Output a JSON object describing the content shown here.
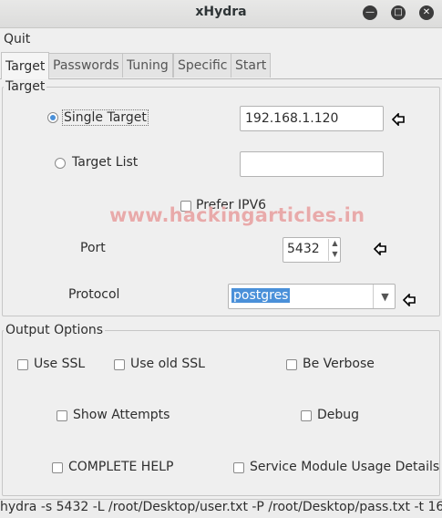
{
  "window": {
    "title": "xHydra"
  },
  "menu": {
    "quit": "Quit"
  },
  "tabs": [
    {
      "label": "Target",
      "active": true
    },
    {
      "label": "Passwords",
      "active": false
    },
    {
      "label": "Tuning",
      "active": false
    },
    {
      "label": "Specific",
      "active": false
    },
    {
      "label": "Start",
      "active": false
    }
  ],
  "target": {
    "frame_title": "Target",
    "single_target_label": "Single Target",
    "single_target_value": "192.168.1.120",
    "target_list_label": "Target List",
    "target_list_value": "",
    "prefer_ipv6_label": "Prefer IPV6",
    "port_label": "Port",
    "port_value": "5432",
    "protocol_label": "Protocol",
    "protocol_value": "postgres"
  },
  "watermark": "www.hackingarticles.in",
  "output": {
    "frame_title": "Output Options",
    "use_ssl": "Use SSL",
    "use_old_ssl": "Use old SSL",
    "be_verbose": "Be Verbose",
    "show_attempts": "Show Attempts",
    "debug": "Debug",
    "complete_help": "COMPLETE HELP",
    "service_module": "Service Module Usage Details"
  },
  "status": {
    "command": "hydra -s 5432 -L /root/Desktop/user.txt -P /root/Desktop/pass.txt -t 16..."
  },
  "colors": {
    "accent": "#4a90d9",
    "watermark": "#e8a3a3"
  }
}
